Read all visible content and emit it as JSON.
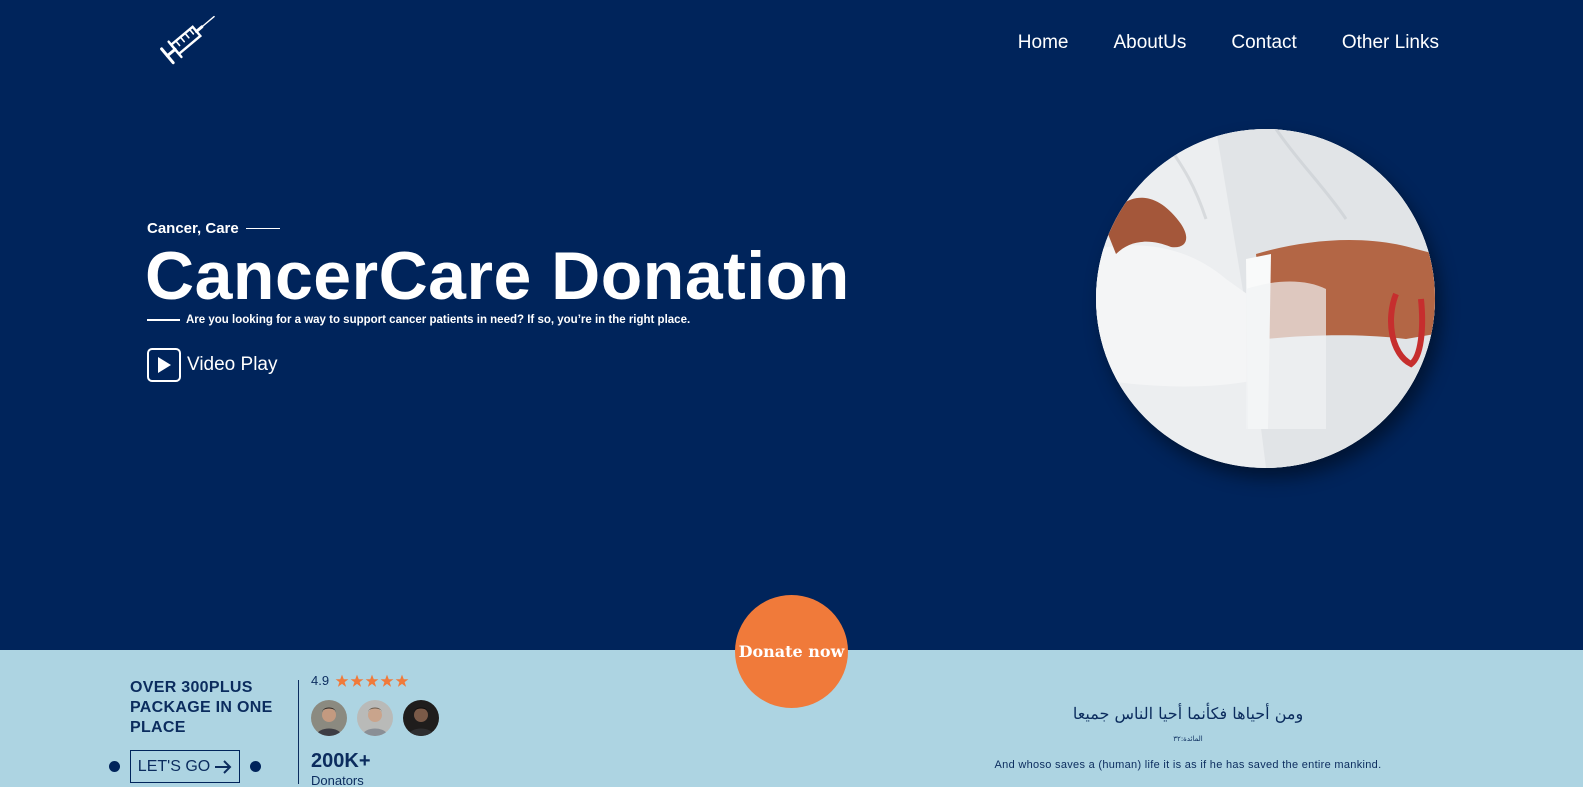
{
  "nav": {
    "items": [
      "Home",
      "AboutUs",
      "Contact",
      "Other Links"
    ]
  },
  "hero": {
    "kicker": "Cancer, Care",
    "title": "CancerCare Donation",
    "subtitle": "Are you looking for a way to support cancer patients in need? If so, you’re in the right place.",
    "video_label": "Video Play"
  },
  "donate": {
    "label": "Donate now"
  },
  "promo": {
    "headline": "OVER 300PLUS PACKAGE IN ONE PLACE",
    "cta_label": "LET'S GO"
  },
  "stats": {
    "rating": "4.9",
    "stars_filled": 5,
    "stars_total": 5,
    "count": "200K+",
    "count_label": "Donators"
  },
  "quote": {
    "arabic": "ومن أحياها فكأنما أحيا الناس جميعا",
    "reference": "المائدة:٣٢",
    "translation": "And whoso saves a (human) life it is as if he has saved the entire mankind."
  },
  "colors": {
    "hero_bg": "#00245b",
    "band_bg": "#add4e2",
    "accent": "#f07a3a",
    "text_dark": "#0b2c5e"
  },
  "icons": {
    "logo": "syringe-icon",
    "video": "play-icon",
    "arrow": "arrow-right-icon",
    "star": "star-icon"
  }
}
